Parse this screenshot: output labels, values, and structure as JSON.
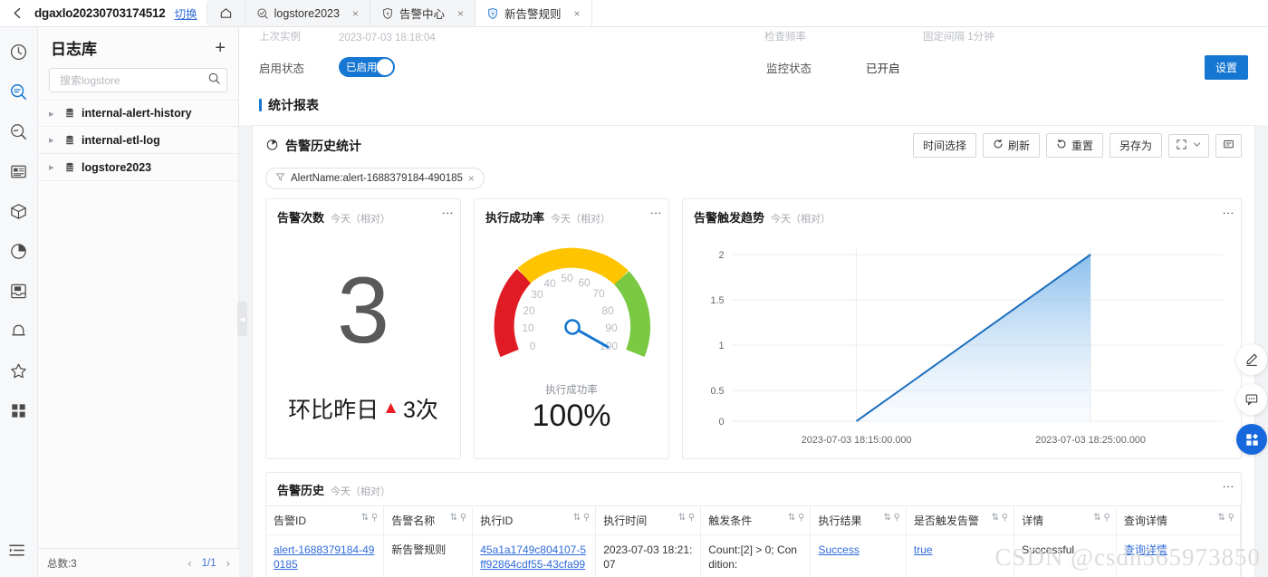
{
  "topbar": {
    "back_icon": "chevron-left-icon",
    "project_name": "dgaxlo20230703174512",
    "switch_label": "切换",
    "home_icon": "home-icon",
    "tabs": [
      {
        "label": "logstore2023",
        "icon": "search-circle-icon",
        "close": "×",
        "active": false
      },
      {
        "label": "告警中心",
        "icon": "alert-shield-icon",
        "close": "×",
        "active": false
      },
      {
        "label": "新告警规则",
        "icon": "alert-shield-icon",
        "close": "×",
        "active": true
      }
    ]
  },
  "rail": {
    "items": [
      {
        "name": "clock-icon",
        "active": false
      },
      {
        "name": "search-icon",
        "active": true
      },
      {
        "name": "refresh-search-icon",
        "active": false
      },
      {
        "name": "report-list-icon",
        "active": false
      },
      {
        "name": "package-icon",
        "active": false
      },
      {
        "name": "pie-chart-icon",
        "active": false
      },
      {
        "name": "import-inbox-icon",
        "active": false
      },
      {
        "name": "bell-icon",
        "active": false
      },
      {
        "name": "star-icon",
        "active": false
      },
      {
        "name": "grid-icon",
        "active": false
      }
    ],
    "collapse_icon": "collapse-menu-icon"
  },
  "sidebar": {
    "title": "日志库",
    "add_label": "+",
    "search_placeholder": "搜索logstore",
    "search_value": "",
    "items": [
      {
        "label": "internal-alert-history"
      },
      {
        "label": "internal-etl-log"
      },
      {
        "label": "logstore2023"
      }
    ],
    "footer": {
      "total": "总数:3",
      "prev": "‹",
      "page": "1/1",
      "next": "›"
    },
    "collapse_handle": "◀"
  },
  "detail": {
    "cut_row": {
      "label": "上次实例",
      "value": "2023-07-03 18:18:04",
      "label2": "检查频率",
      "value2": "固定间隔 1分钟"
    },
    "enable_label": "启用状态",
    "enable_value": "已启用",
    "monitor_label": "监控状态",
    "monitor_value": "已开启",
    "settings_button": "设置",
    "section_title": "统计报表"
  },
  "report": {
    "title": "告警历史统计",
    "title_icon": "pie-clock-icon",
    "toolbar": [
      {
        "label": "时间选择",
        "icon": ""
      },
      {
        "label": "刷新",
        "icon": "refresh-icon"
      },
      {
        "label": "重置",
        "icon": "reset-icon"
      },
      {
        "label": "另存为",
        "icon": ""
      }
    ],
    "fullscreen_icon": "fullscreen-icon",
    "chevron_icon": "chevron-down-icon",
    "comment_icon": "comment-icon",
    "filter_chip": {
      "icon": "filter-icon",
      "text": "AlertName:alert-1688379184-490185",
      "close": "×"
    },
    "relative_label": "今天（相对）",
    "menu_icon": "⋮"
  },
  "cards": {
    "alert_count": {
      "title": "告警次数",
      "subtitle": "今天（相对）",
      "value": "3",
      "compare_text": "环比昨日",
      "compare_arrow": "▲",
      "compare_value": "3次"
    },
    "success_rate": {
      "title": "执行成功率",
      "subtitle": "今天（相对）",
      "label": "执行成功率",
      "value": "100%"
    },
    "trend": {
      "title": "告警触发趋势",
      "subtitle": "今天（相对）"
    }
  },
  "chart_data": [
    {
      "type": "bar",
      "title": "告警次数",
      "subtitle": "今天（相对）",
      "categories": [
        "今天"
      ],
      "values": [
        3
      ],
      "annotation": "环比昨日 ▲3次"
    },
    {
      "type": "gauge",
      "title": "执行成功率",
      "subtitle": "今天（相对）",
      "value": 100,
      "ylim": [
        0,
        100
      ],
      "tick_labels": [
        "0",
        "10",
        "20",
        "30",
        "40",
        "50",
        "60",
        "70",
        "80",
        "90",
        "100"
      ],
      "bands": [
        {
          "from": 0,
          "to": 22,
          "color": "#e01b24"
        },
        {
          "from": 22,
          "to": 62,
          "color": "#ffc400"
        },
        {
          "from": 62,
          "to": 100,
          "color": "#7ac943"
        }
      ],
      "needle_color": "#1677d2",
      "value_label": "100%",
      "xlabel": "",
      "ylabel": ""
    },
    {
      "type": "area",
      "title": "告警触发趋势",
      "subtitle": "今天（相对）",
      "x": [
        "2023-07-03 18:15:00.000",
        "2023-07-03 18:25:00.000"
      ],
      "values": [
        0,
        2
      ],
      "ylim": [
        0,
        2
      ],
      "ytick_labels": [
        "0",
        "0.5",
        "1",
        "1.5",
        "2"
      ],
      "xtick_labels": [
        "2023-07-03 18:15:00.000",
        "2023-07-03 18:25:00.000"
      ],
      "line_color": "#1f6fbd",
      "grid": true,
      "legend": "none",
      "xlabel": "",
      "ylabel": ""
    }
  ],
  "history": {
    "title": "告警历史",
    "subtitle": "今天（相对）",
    "columns": [
      "告警ID",
      "告警名称",
      "执行ID",
      "执行时间",
      "触发条件",
      "执行结果",
      "是否触发告警",
      "详情",
      "查询详情"
    ],
    "rows": [
      {
        "alert_id": "alert-1688379184-490185",
        "alert_name": "新告警规则",
        "exec_id": "45a1a1749c804107-5ff92864cdf55-43cfa99",
        "exec_time": "2023-07-03 18:21:07",
        "condition": "Count:[2] > 0; Condition:",
        "result": "Success",
        "triggered": "true",
        "detail": "Successful",
        "query_detail": "查询详情"
      }
    ],
    "sort_icon": "sort-icon",
    "filter_icon": "column-search-icon"
  },
  "float_buttons": [
    {
      "name": "edit-pencil-icon",
      "style": "white"
    },
    {
      "name": "feedback-chat-icon",
      "style": "white"
    },
    {
      "name": "app-grid-icon",
      "style": "blue"
    }
  ],
  "watermark": "CSDN @csdn565973850",
  "colors": {
    "accent": "#1677d2",
    "link": "#2f6bd8",
    "danger": "#ee1c25",
    "gauge_red": "#e01b24",
    "gauge_yellow": "#ffc400",
    "gauge_green": "#7ac943",
    "chart_line": "#1f6fbd"
  }
}
